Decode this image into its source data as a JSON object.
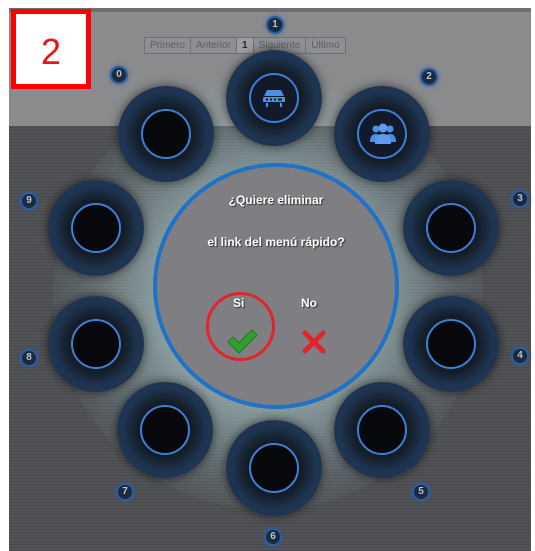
{
  "step_label": "2",
  "pagination": [
    "Primero",
    "Anterior",
    "1",
    "Siguiente",
    "Último"
  ],
  "dialog": {
    "line1": "¿Quiere eliminar",
    "line2": "el link del menú rápido?",
    "yes_label": "Si",
    "no_label": "No"
  },
  "nodes": [
    {
      "index": "0",
      "icon": "empty"
    },
    {
      "index": "1",
      "icon": "router-icon"
    },
    {
      "index": "2",
      "icon": "users-icon"
    },
    {
      "index": "3",
      "icon": "empty"
    },
    {
      "index": "4",
      "icon": "empty"
    },
    {
      "index": "5",
      "icon": "empty"
    },
    {
      "index": "6",
      "icon": "empty"
    },
    {
      "index": "7",
      "icon": "empty"
    },
    {
      "index": "8",
      "icon": "empty"
    },
    {
      "index": "9",
      "icon": "empty"
    }
  ],
  "colors": {
    "ring_blue": "#1e73c9",
    "highlight_red": "#e2242b",
    "check_green": "#2fa12a",
    "cross_red": "#e0242a"
  }
}
